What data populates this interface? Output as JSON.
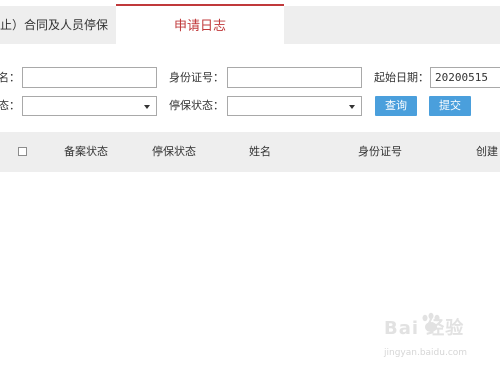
{
  "tabs": [
    {
      "label": "止）合同及人员停保"
    },
    {
      "label": "申请日志"
    }
  ],
  "form": {
    "row1": {
      "name_label": "名：",
      "name_value": "",
      "id_label": "身份证号：",
      "id_value": "",
      "start_date_label": "起始日期：",
      "start_date_value": "20200515"
    },
    "row2": {
      "status_label": "态：",
      "status_value": "",
      "stop_status_label": "停保状态：",
      "stop_status_value": "",
      "query_label": "查询",
      "submit_label": "提交"
    }
  },
  "table": {
    "columns": [
      "备案状态",
      "停保状态",
      "姓名",
      "身份证号",
      "创建"
    ]
  },
  "watermark": {
    "text": "Bai 经验",
    "url": "jingyan.baidu.com"
  },
  "colors": {
    "accent": "#c0393b",
    "button": "#4a9fdc",
    "header_bg": "#eeeeee"
  }
}
